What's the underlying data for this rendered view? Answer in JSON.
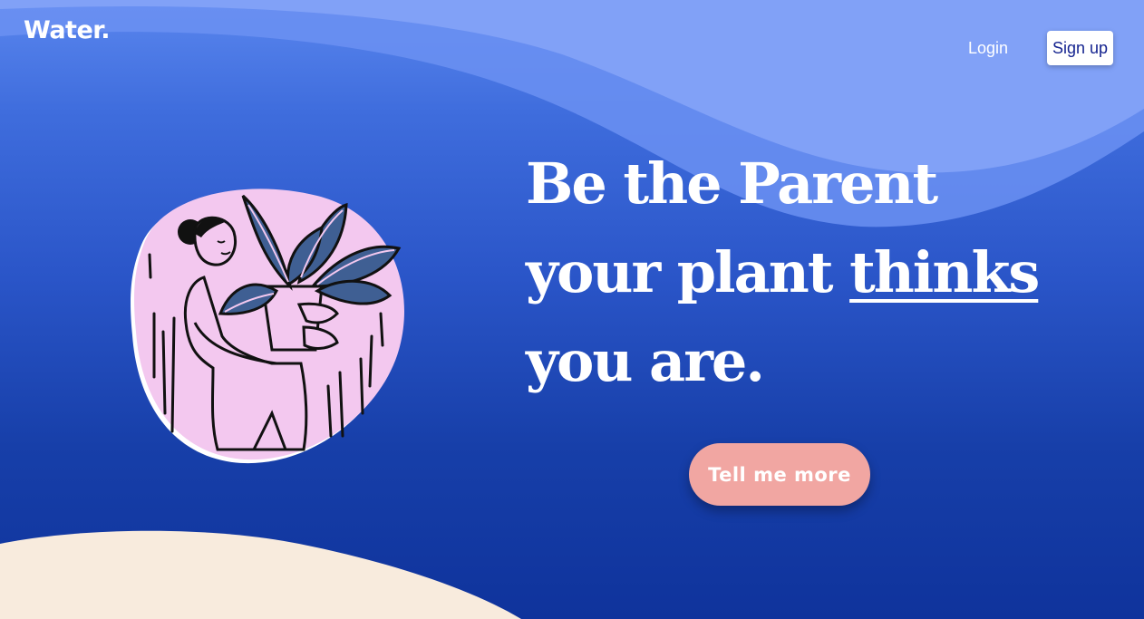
{
  "header": {
    "logo_text": "Water.",
    "login_label": "Login",
    "signup_label": "Sign up"
  },
  "hero": {
    "headline_line1": "Be the Parent",
    "headline_line2_pre": "your plant ",
    "headline_line2_emphasis": "thinks",
    "headline_line3": "you are.",
    "cta_label": "Tell me more"
  },
  "illustration": {
    "icon": "person-holding-plant-illustration"
  },
  "colors": {
    "background_top": "#5a86ee",
    "background_bottom": "#0f339c",
    "wave_light": "#84a3f7",
    "wave_mid": "#6b91f2",
    "blob_pink": "#f3c8ef",
    "leaf_blue": "#3f5f93",
    "cta": "#f1a6a2",
    "sand": "#f8ebdd",
    "signup_text": "#14238f"
  }
}
